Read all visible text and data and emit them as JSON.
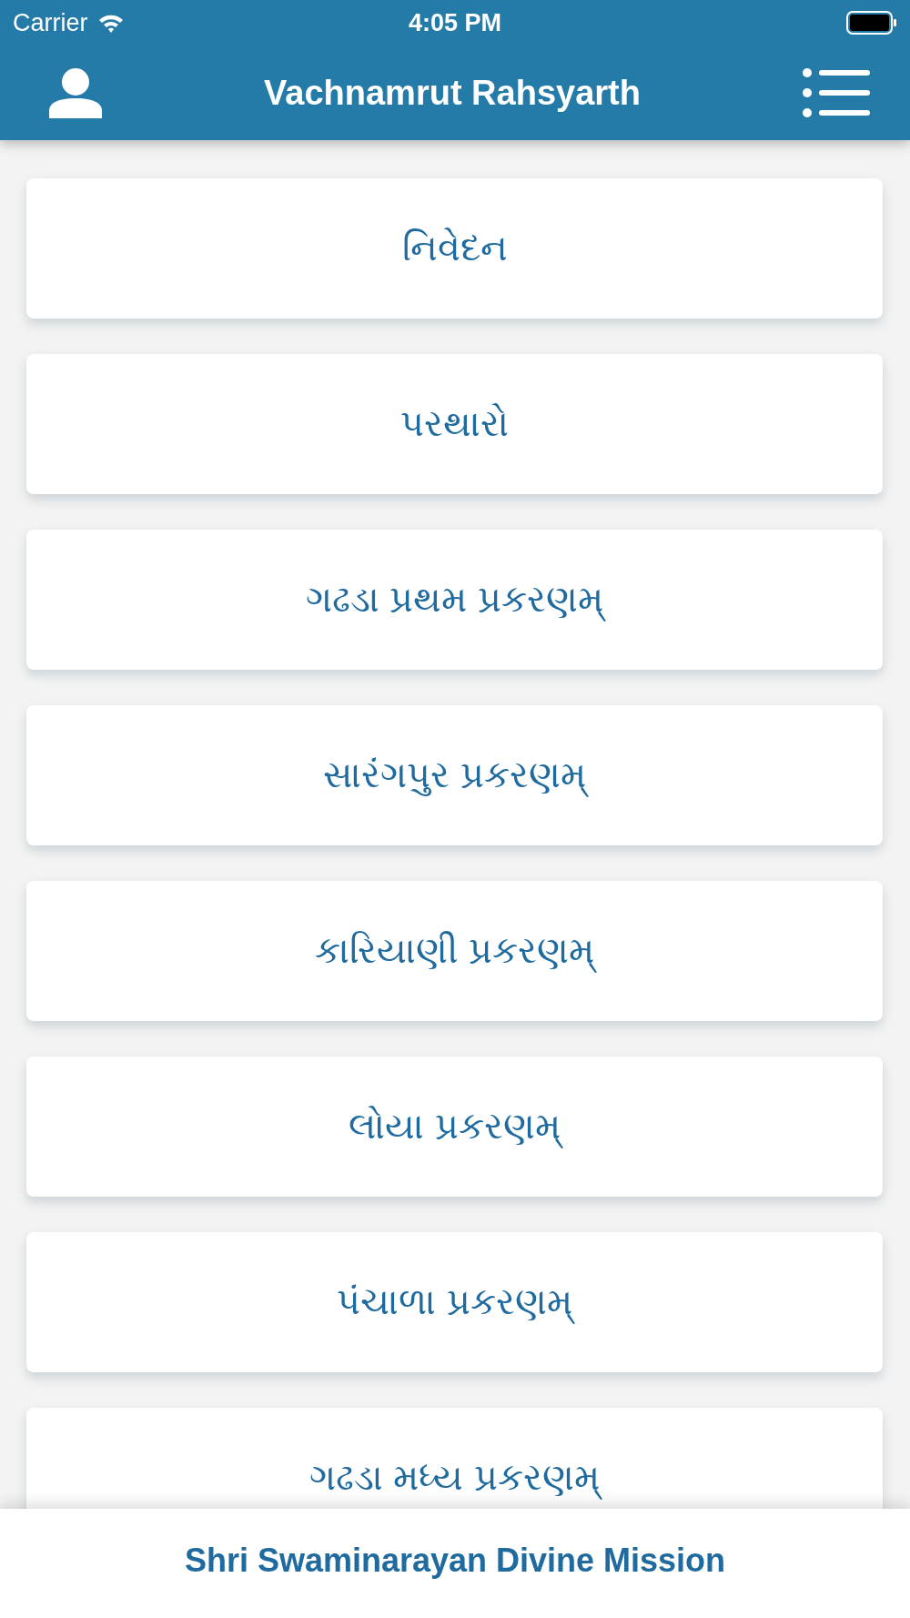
{
  "status_bar": {
    "carrier": "Carrier",
    "time": "4:05 PM"
  },
  "header": {
    "title": "Vachnamrut Rahsyarth"
  },
  "items": [
    {
      "label": "નિવેદન"
    },
    {
      "label": "પરથારો"
    },
    {
      "label": "ગઢડા પ્રથમ પ્રકરણમ્"
    },
    {
      "label": "સારંગપુર પ્રકરણમ્"
    },
    {
      "label": "કારિયાણી પ્રકરણમ્"
    },
    {
      "label": "લોયા પ્રકરણમ્"
    },
    {
      "label": "પંચાળા પ્રકરણમ્"
    },
    {
      "label": "ગઢડા મધ્ય પ્રકરણમ્"
    }
  ],
  "footer": {
    "text": "Shri Swaminarayan Divine Mission"
  }
}
